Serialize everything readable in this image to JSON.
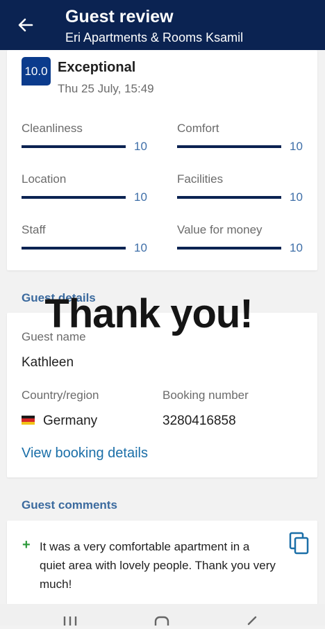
{
  "header": {
    "title": "Guest review",
    "subtitle": "Eri Apartments & Rooms Ksamil"
  },
  "review": {
    "score": "10.0",
    "score_word": "Exceptional",
    "date": "Thu 25 July, 15:49",
    "categories": [
      {
        "label": "Cleanliness",
        "value": "10",
        "fraction": 1.0
      },
      {
        "label": "Comfort",
        "value": "10",
        "fraction": 1.0
      },
      {
        "label": "Location",
        "value": "10",
        "fraction": 1.0
      },
      {
        "label": "Facilities",
        "value": "10",
        "fraction": 1.0
      },
      {
        "label": "Staff",
        "value": "10",
        "fraction": 1.0
      },
      {
        "label": "Value for money",
        "value": "10",
        "fraction": 1.0
      }
    ]
  },
  "overlay_text": "Thank you!",
  "guest_details": {
    "heading": "Guest details",
    "name_label": "Guest name",
    "name": "Kathleen",
    "country_label": "Country/region",
    "country": "Germany",
    "booking_label": "Booking number",
    "booking_number": "3280416858",
    "view_link": "View booking details"
  },
  "comments": {
    "heading": "Guest comments",
    "positive": "It was a very comfortable apartment in a quiet area with lovely people. Thank you very much!"
  },
  "colors": {
    "header_bg": "#0b2352",
    "badge_bg": "#0b3b8c",
    "bar_fill": "#0b2352",
    "link": "#1b6fa8",
    "positive": "#2e9a3c"
  },
  "icons": [
    "back-arrow-icon",
    "germany-flag-icon",
    "plus-icon",
    "copy-icon",
    "recent-apps-icon",
    "home-icon",
    "back-nav-icon"
  ]
}
